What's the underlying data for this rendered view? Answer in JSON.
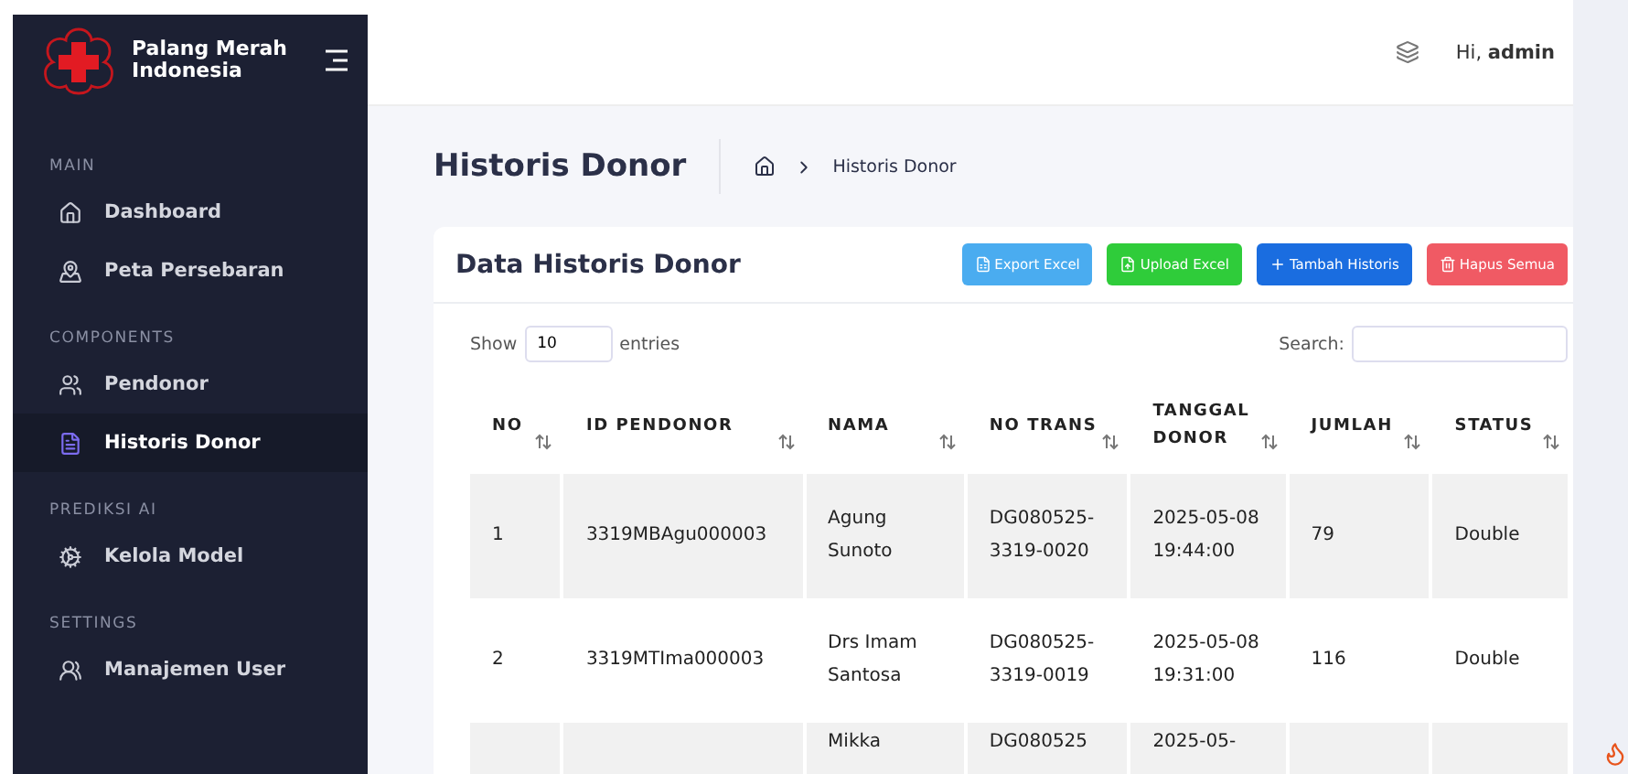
{
  "brand": {
    "name": "Palang Merah Indonesia"
  },
  "user": {
    "greeting": "Hi,",
    "name": "admin"
  },
  "sidebar": {
    "sections": [
      {
        "title": "MAIN",
        "items": [
          {
            "label": "Dashboard",
            "selected": false
          },
          {
            "label": "Peta Persebaran",
            "selected": false
          }
        ]
      },
      {
        "title": "COMPONENTS",
        "items": [
          {
            "label": "Pendonor",
            "selected": false
          },
          {
            "label": "Historis Donor",
            "selected": true
          }
        ]
      },
      {
        "title": "PREDIKSI AI",
        "items": [
          {
            "label": "Kelola Model",
            "selected": false
          }
        ]
      },
      {
        "title": "SETTINGS",
        "items": [
          {
            "label": "Manajemen User",
            "selected": false
          }
        ]
      }
    ]
  },
  "page": {
    "title": "Historis Donor",
    "breadcrumb": "Historis Donor"
  },
  "card": {
    "title": "Data Historis Donor",
    "buttons": [
      {
        "label": "Export Excel",
        "kind": "export"
      },
      {
        "label": "Upload Excel",
        "kind": "upload"
      },
      {
        "label": "Tambah Historis",
        "kind": "add"
      },
      {
        "label": "Hapus Semua",
        "kind": "delete"
      }
    ]
  },
  "table": {
    "show_label": "Show",
    "entries_value": "10",
    "entries_label": "entries",
    "search_label": "Search:",
    "columns": [
      "NO",
      "ID PENDONOR",
      "NAMA",
      "NO TRANS",
      "TANGGAL DONOR",
      "JUMLAH",
      "STATUS"
    ],
    "rows": [
      {
        "cells": [
          "1",
          "3319MBAgu000003",
          "Agung Sunoto",
          "DG080525-3319-0020",
          "2025-05-08 19:44:00",
          "79",
          "Double"
        ]
      },
      {
        "cells": [
          "2",
          "3319MTIma000003",
          "Drs Imam Santosa",
          "DG080525-3319-0019",
          "2025-05-08 19:31:00",
          "116",
          "Double"
        ]
      },
      {
        "cells": [
          "",
          "",
          "Mikka",
          "DG080525",
          "2025-05-",
          "",
          ""
        ]
      }
    ]
  }
}
